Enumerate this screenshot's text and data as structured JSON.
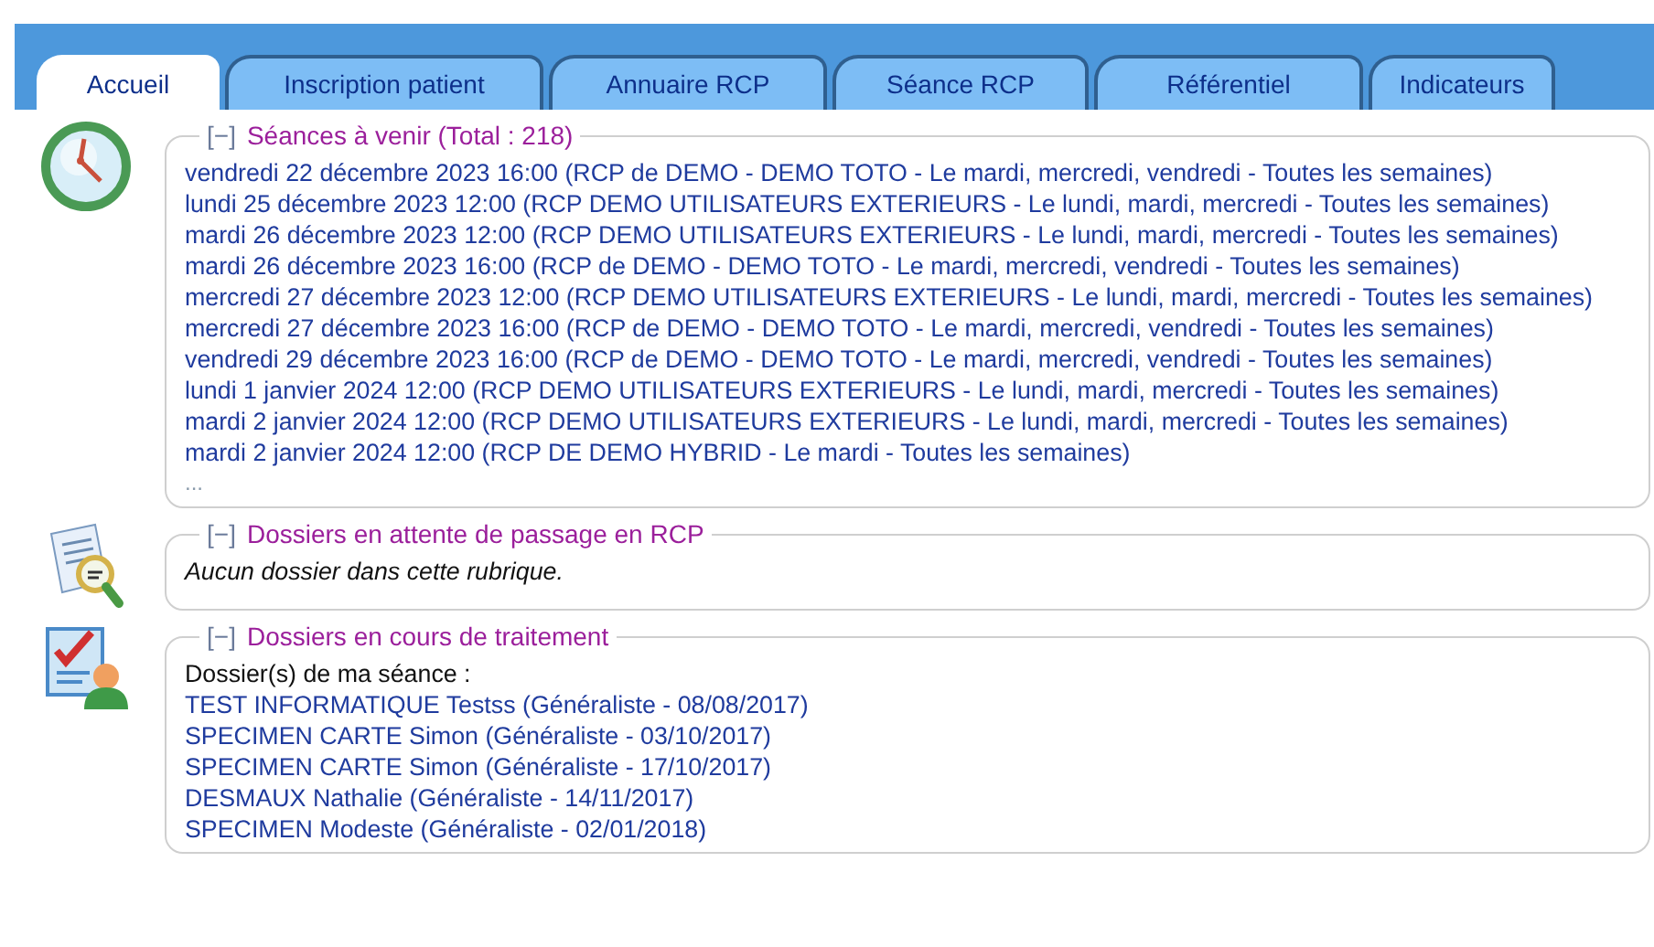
{
  "tabs": [
    {
      "label": "Accueil",
      "selected": true
    },
    {
      "label": "Inscription patient",
      "selected": false
    },
    {
      "label": "Annuaire RCP",
      "selected": false
    },
    {
      "label": "Séance RCP",
      "selected": false
    },
    {
      "label": "Référentiel",
      "selected": false
    },
    {
      "label": "Indicateurs",
      "selected": false
    }
  ],
  "sections": [
    {
      "toggle": "[−]",
      "title": "Séances à venir (Total : 218)",
      "items": [
        "vendredi 22 décembre 2023 16:00 (RCP de DEMO - DEMO TOTO - Le mardi, mercredi, vendredi - Toutes les semaines)",
        "lundi 25 décembre 2023 12:00 (RCP DEMO UTILISATEURS EXTERIEURS - Le lundi, mardi, mercredi - Toutes les semaines)",
        "mardi 26 décembre 2023 12:00 (RCP DEMO UTILISATEURS EXTERIEURS - Le lundi, mardi, mercredi - Toutes les semaines)",
        "mardi 26 décembre 2023 16:00 (RCP de DEMO - DEMO TOTO - Le mardi, mercredi, vendredi - Toutes les semaines)",
        "mercredi 27 décembre 2023 12:00 (RCP DEMO UTILISATEURS EXTERIEURS - Le lundi, mardi, mercredi - Toutes les semaines)",
        "mercredi 27 décembre 2023 16:00 (RCP de DEMO - DEMO TOTO - Le mardi, mercredi, vendredi - Toutes les semaines)",
        "vendredi 29 décembre 2023 16:00 (RCP de DEMO - DEMO TOTO - Le mardi, mercredi, vendredi - Toutes les semaines)",
        "lundi 1 janvier 2024 12:00 (RCP DEMO UTILISATEURS EXTERIEURS - Le lundi, mardi, mercredi - Toutes les semaines)",
        "mardi 2 janvier 2024 12:00 (RCP DEMO UTILISATEURS EXTERIEURS - Le lundi, mardi, mercredi - Toutes les semaines)",
        "mardi 2 janvier 2024 12:00 (RCP DE DEMO HYBRID - Le mardi - Toutes les semaines)"
      ],
      "more": "..."
    },
    {
      "toggle": "[−]",
      "title": "Dossiers en attente de passage en RCP",
      "empty_message": "Aucun dossier dans cette rubrique."
    },
    {
      "toggle": "[−]",
      "title": "Dossiers en cours de traitement",
      "subtitle": "Dossier(s) de ma séance :",
      "items": [
        "TEST INFORMATIQUE Testss (Généraliste - 08/08/2017)",
        "SPECIMEN CARTE Simon (Généraliste - 03/10/2017)",
        "SPECIMEN CARTE Simon (Généraliste - 17/10/2017)",
        "DESMAUX Nathalie (Généraliste - 14/11/2017)",
        "SPECIMEN Modeste (Généraliste - 02/01/2018)"
      ]
    }
  ]
}
